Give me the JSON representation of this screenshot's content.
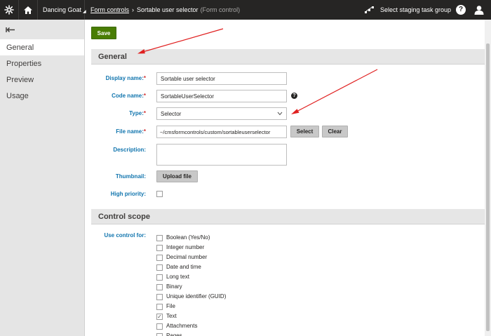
{
  "topbar": {
    "site_name": "Dancing Goat",
    "breadcrumb_link": "Form controls",
    "breadcrumb_current": "Sortable user selector",
    "breadcrumb_sub": "(Form control)",
    "staging_label": "Select staging task group",
    "help_label": "?"
  },
  "sidebar": {
    "items": [
      {
        "label": "General"
      },
      {
        "label": "Properties"
      },
      {
        "label": "Preview"
      },
      {
        "label": "Usage"
      }
    ]
  },
  "toolbar": {
    "save_label": "Save"
  },
  "general": {
    "title": "General",
    "display_name_label": "Display name:",
    "display_name_value": "Sortable user selector",
    "code_name_label": "Code name:",
    "code_name_value": "SortableUserSelector",
    "type_label": "Type:",
    "type_value": "Selector",
    "file_name_label": "File name:",
    "file_name_value": "~/cmsformcontrols/custom/sortableuserselector",
    "select_label": "Select",
    "clear_label": "Clear",
    "description_label": "Description:",
    "description_value": "",
    "thumbnail_label": "Thumbnail:",
    "upload_label": "Upload file",
    "high_priority_label": "High priority:",
    "required_mark": "*",
    "help_mark": "?"
  },
  "scope": {
    "title": "Control scope",
    "use_for_label": "Use control for:",
    "options": [
      {
        "label": "Boolean (Yes/No)",
        "checked": false
      },
      {
        "label": "Integer number",
        "checked": false
      },
      {
        "label": "Decimal number",
        "checked": false
      },
      {
        "label": "Date and time",
        "checked": false
      },
      {
        "label": "Long text",
        "checked": false
      },
      {
        "label": "Binary",
        "checked": false
      },
      {
        "label": "Unique identifier (GUID)",
        "checked": false
      },
      {
        "label": "File",
        "checked": false
      },
      {
        "label": "Text",
        "checked": true
      },
      {
        "label": "Attachments",
        "checked": false
      },
      {
        "label": "Pages",
        "checked": false
      }
    ]
  },
  "colors": {
    "topbar": "#262524",
    "save_button": "#497d04",
    "label_blue": "#1175ae",
    "annotation_arrow": "#e02020"
  }
}
